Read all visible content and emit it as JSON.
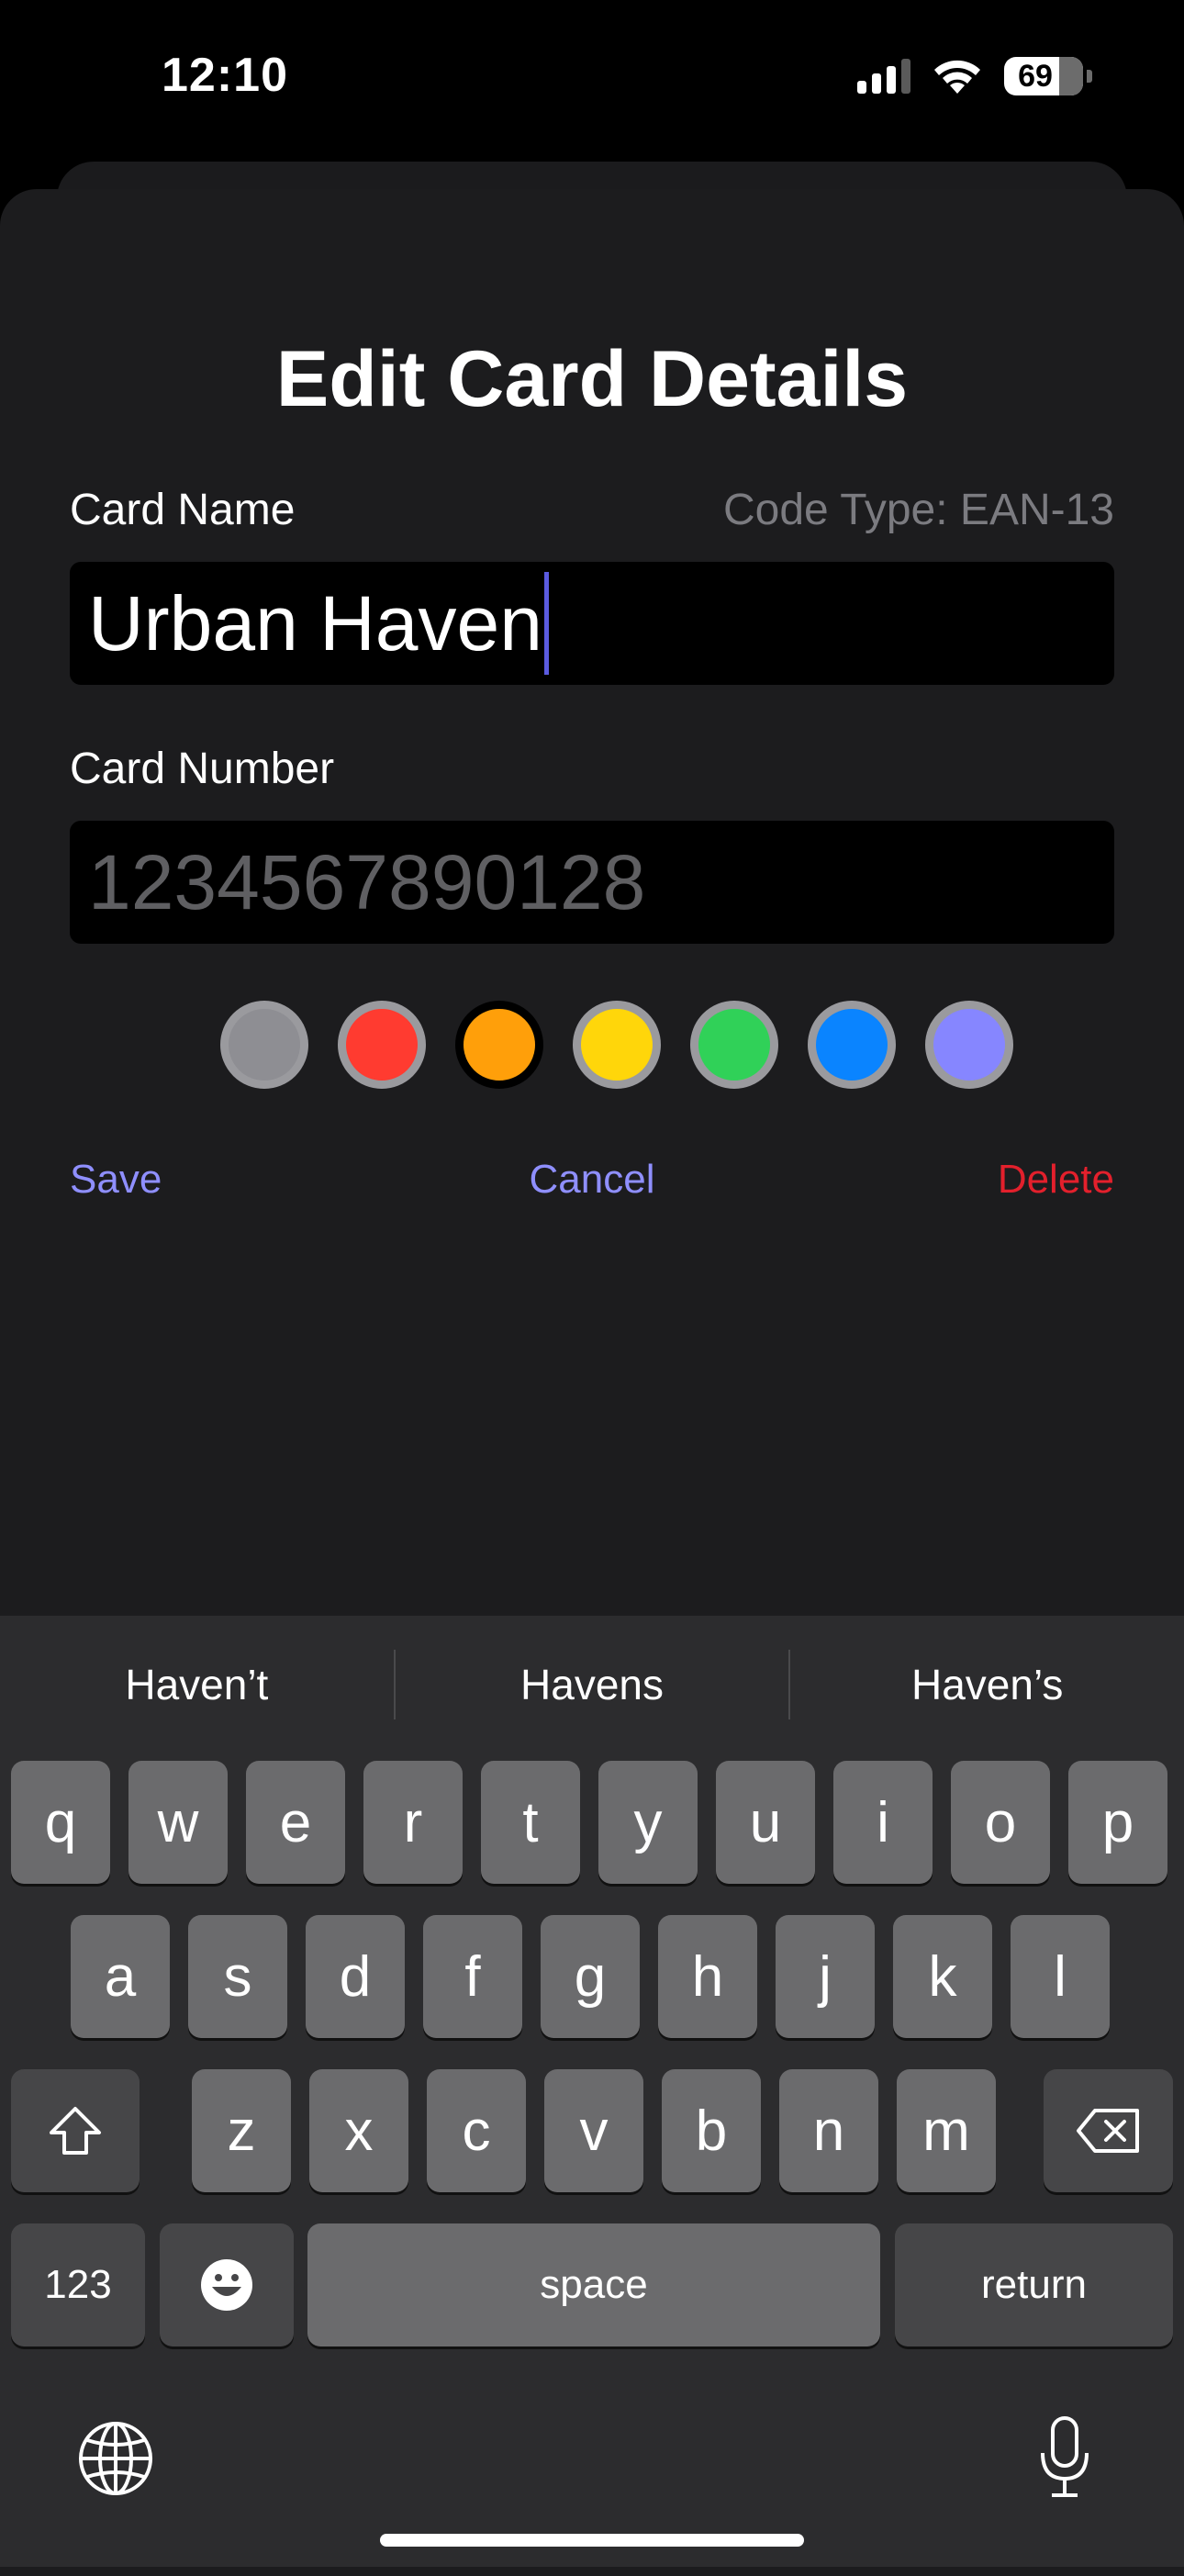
{
  "status_bar": {
    "time": "12:10",
    "battery": "69"
  },
  "form": {
    "title": "Edit Card Details",
    "card_name_label": "Card Name",
    "code_type": "Code Type: EAN-13",
    "card_name_value": "Urban Haven",
    "card_number_label": "Card Number",
    "card_number_placeholder": "1234567890128",
    "colors": [
      "#8e8e93",
      "#ff3b30",
      "#ff9f0a",
      "#ffd60a",
      "#30d158",
      "#0a84ff",
      "#8686ff"
    ],
    "selected_color": "#ff9f0a"
  },
  "actions": {
    "save": "Save",
    "cancel": "Cancel",
    "delete": "Delete"
  },
  "keyboard": {
    "suggestions": [
      "Haven’t",
      "Havens",
      "Haven’s"
    ],
    "row1": [
      "q",
      "w",
      "e",
      "r",
      "t",
      "y",
      "u",
      "i",
      "o",
      "p"
    ],
    "row2": [
      "a",
      "s",
      "d",
      "f",
      "g",
      "h",
      "j",
      "k",
      "l"
    ],
    "row3": [
      "z",
      "x",
      "c",
      "v",
      "b",
      "n",
      "m"
    ],
    "numbers_key": "123",
    "space_key": "space",
    "return_key": "return",
    "icons": [
      "shift-icon",
      "backspace-icon",
      "emoji-icon",
      "globe-icon",
      "microphone-icon"
    ]
  }
}
